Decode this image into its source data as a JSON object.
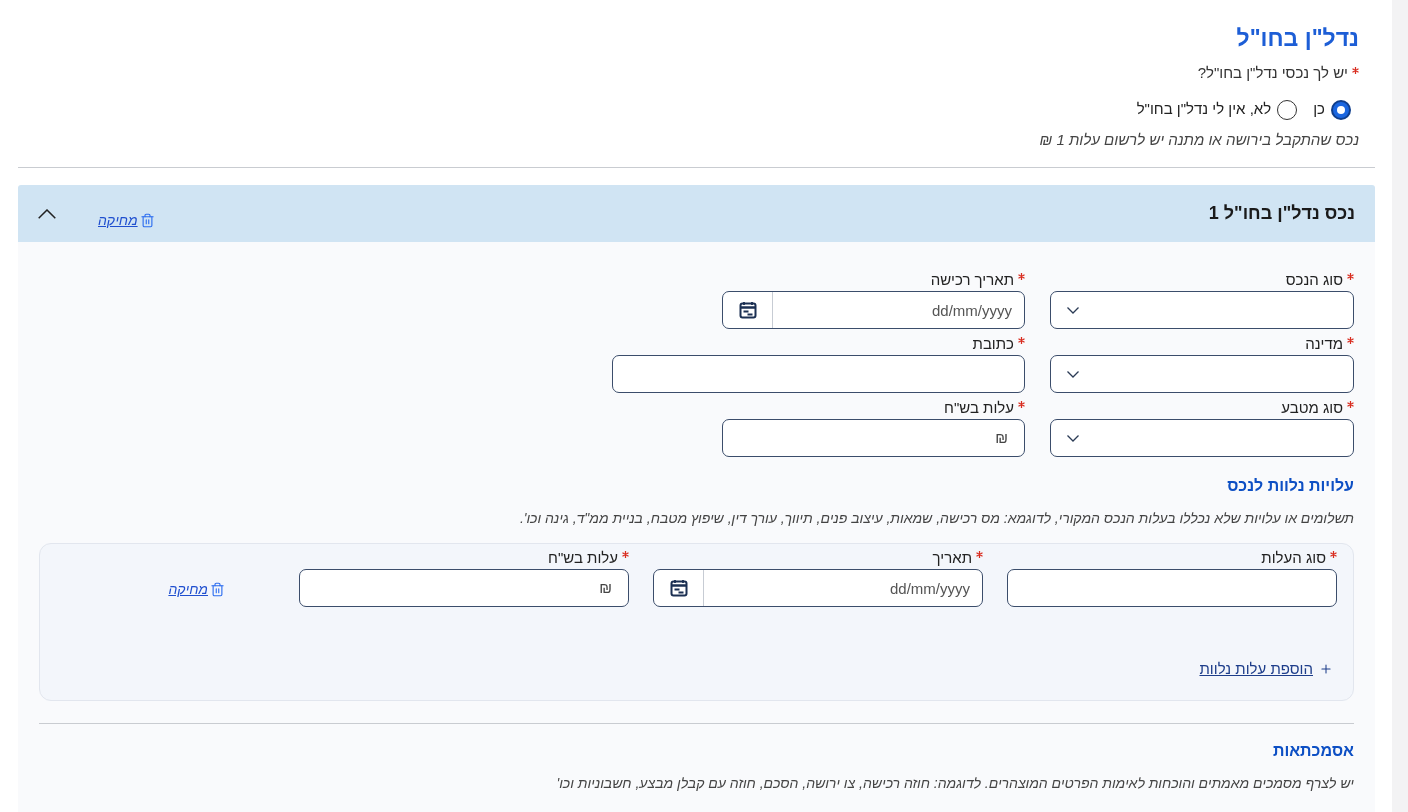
{
  "section": {
    "title": "נדל\"ן בחו\"ל",
    "question": {
      "label": "יש לך נכסי נדל\"ן בחו\"ל?",
      "required": true
    },
    "options": [
      {
        "label": "כן",
        "selected": true
      },
      {
        "label": "לא, אין לי נדל\"ן בחו\"ל",
        "selected": false
      }
    ],
    "note": "נכס שהתקבל בירושה או מתנה יש לרשום עלות 1 ₪"
  },
  "property": {
    "title": "נכס נדל\"ן בחו\"ל 1",
    "expanded": true,
    "delete_link": "מחיקה",
    "fields": [
      {
        "kind": "select",
        "label": "סוג הנכס",
        "required": true
      },
      {
        "kind": "date",
        "label": "תאריך רכישה",
        "required": true,
        "placeholder": "dd/mm/yyyy"
      },
      {
        "kind": "select",
        "label": "מדינה",
        "required": true
      },
      {
        "kind": "text",
        "label": "כתובת",
        "required": true
      },
      {
        "kind": "select",
        "label": "סוג מטבע",
        "required": true
      },
      {
        "kind": "currency",
        "label": "עלות בש\"ח",
        "required": true,
        "symbol": "₪"
      }
    ],
    "costs": {
      "title": "עלויות נלוות לנכס",
      "description": "תשלומים או עלויות שלא נכללו בעלות הנכס המקורי, לדוגמא: מס רכישה, שמאות, עיצוב פנים, תיווך, עורך דין, שיפוץ מטבח, בניית ממ\"ד, גינה וכו'.",
      "items": [
        {
          "delete_link": "מחיקה",
          "fields": [
            {
              "kind": "text",
              "label": "סוג העלות",
              "required": true
            },
            {
              "kind": "date",
              "label": "תאריך",
              "required": true,
              "placeholder": "dd/mm/yyyy"
            },
            {
              "kind": "currency",
              "label": "עלות בש\"ח",
              "required": true,
              "symbol": "₪"
            }
          ]
        }
      ],
      "add_link": "הוספת עלות נלוות"
    },
    "documents": {
      "title": "אסמכתאות",
      "description": "יש לצרף מסמכים מאמתים והוכחות לאימות הפרטים המוצהרים. לדוגמה: חוזה רכישה, צו ירושה, הסכם, חוזה עם קבלן מבצע, חשבוניות וכו'"
    }
  }
}
